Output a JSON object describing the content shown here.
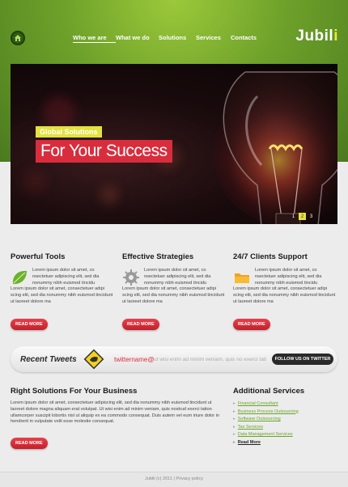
{
  "header": {
    "logo_main": "Jubil",
    "logo_accent": "i",
    "nav": [
      "Who we are",
      "What we do",
      "Solutions",
      "Services",
      "Contacts"
    ]
  },
  "slider": {
    "caption_line1": "Global Solutions",
    "caption_line2": "For Your Success",
    "pages": [
      "1",
      "2",
      "3"
    ],
    "active_page": "2"
  },
  "columns": [
    {
      "title": "Powerful Tools",
      "lead": "Lorem ipsum dolor sit amet, co nsectetuer adipiscing elit, sed dia nonummy nibh euismod tincidu",
      "body": "Lorem ipsum dolor sit amet, consectetuer adipi scing elit, sed dia nonummy nibh euismod tincidunt ut laoreet dolore ma",
      "button": "READ MORE"
    },
    {
      "title": "Effective Strategies",
      "lead": "Lorem ipsum dolor sit amet, co nsectetuer adipiscing elit, sed dia nonummy nibh euismod tincidu",
      "body": "Lorem ipsum dolor sit amet, consectetuer adipi scing elit, sed dia nonummy nibh euismod tincidunt ut laoreet dolore ma",
      "button": "READ MORE"
    },
    {
      "title": "24/7 Clients Support",
      "lead": "Lorem ipsum dolor sit amet, co nsectetuer adipiscing elit, sed dia nonummy nibh euismod tincidu",
      "body": "Lorem ipsum dolor sit amet, consectetuer adipi scing elit, sed dia nonummy nibh euismod tincidunt ut laoreet dolore ma",
      "button": "READ MORE"
    }
  ],
  "tweets": {
    "label": "Recent Tweets",
    "handle": "twittername@",
    "text": "ut wisi enim ad minim veniam, quis no exerci tati",
    "follow": "FOLLOW US ON TWITTER"
  },
  "solutions": {
    "title": "Right Solutions For Your Business",
    "text": "Lorem ipsum dolor sit amet, consectetuer adipiscing elit, sed dia nonummy nibh euismod tincidunt ut laoreet dolore magna aliquam erat volutpat. Ut wisi enim ad minim veniam, quis nostrud exerci tation ullamcorper suscipit lobortis nisl ut aliquip ex ea commodo consequat. Duis autem vel eum iriure dolor in hendrerit in vulputate velit esse molestie consequat.",
    "button": "READ MORE"
  },
  "additional": {
    "title": "Additional Services",
    "items": [
      "Financial Consultant",
      "Business Process Outsourcing",
      "Software Outsourcing",
      "Tax Services",
      "Data Management Services"
    ],
    "more": "Read More"
  },
  "footer": {
    "text": "Jubili (c) 2011  |  Privacy policy"
  },
  "colors": {
    "accent_green": "#6ea12a",
    "accent_red": "#d92d3d",
    "accent_yellow": "#e3e23e"
  }
}
